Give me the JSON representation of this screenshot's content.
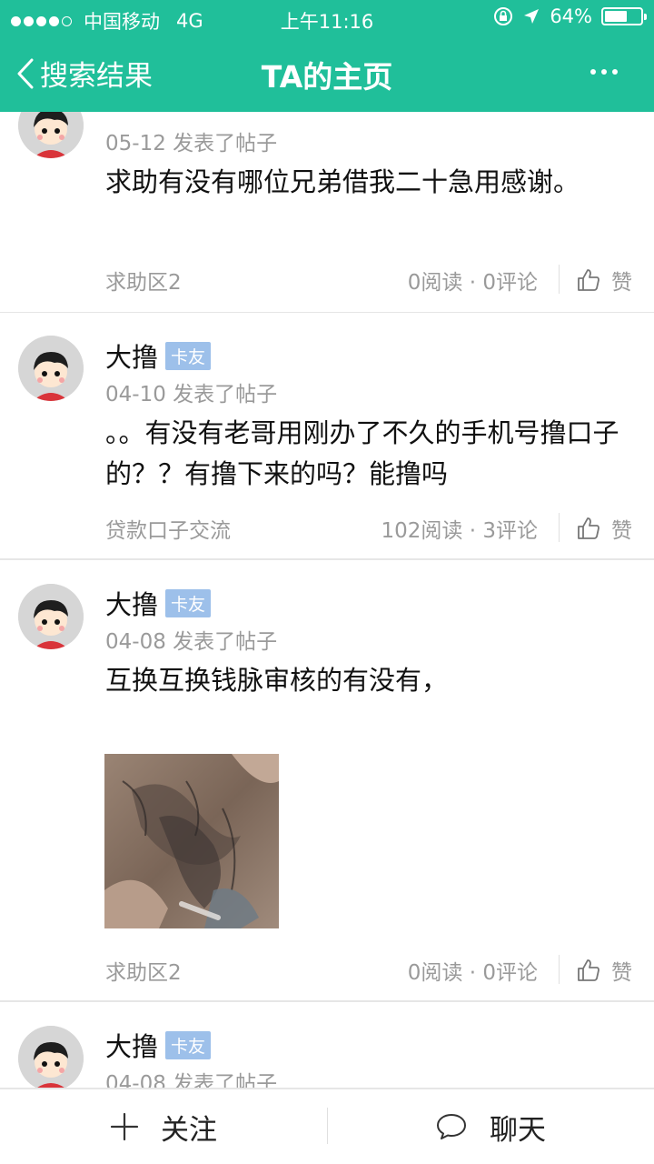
{
  "status_bar": {
    "carrier": "中国移动",
    "network": "4G",
    "time": "上午11:16",
    "battery": "64%",
    "battery_level": 0.64
  },
  "nav": {
    "back_label": "搜索结果",
    "title": "TA的主页",
    "more_icon": "more-horizontal-icon"
  },
  "posts": [
    {
      "username": "",
      "badge": "",
      "meta": "05-12 发表了帖子",
      "content": "求助有没有哪位兄弟借我二十急用感谢。",
      "category": "求助区2",
      "stats": "0阅读 · 0评论",
      "like_label": "赞"
    },
    {
      "username": "大撸",
      "badge": "卡友",
      "meta": "04-10 发表了帖子",
      "content": "。。有没有老哥用刚办了不久的手机号撸口子的？？有撸下来的吗？能撸吗",
      "category": "贷款口子交流",
      "stats": "102阅读 · 3评论",
      "like_label": "赞"
    },
    {
      "username": "大撸",
      "badge": "卡友",
      "meta": "04-08 发表了帖子",
      "content": "互换互换钱脉审核的有没有，",
      "category": "求助区2",
      "stats": "0阅读 · 0评论",
      "like_label": "赞"
    },
    {
      "username": "大撸",
      "badge": "卡友",
      "meta": "04-08 发表了帖子"
    }
  ],
  "bottom_bar": {
    "follow_label": "关注",
    "chat_label": "聊天"
  },
  "colors": {
    "brand_green": "#20bf9a",
    "badge_blue": "#9dc0ea",
    "muted_text": "#9a9a9a"
  }
}
